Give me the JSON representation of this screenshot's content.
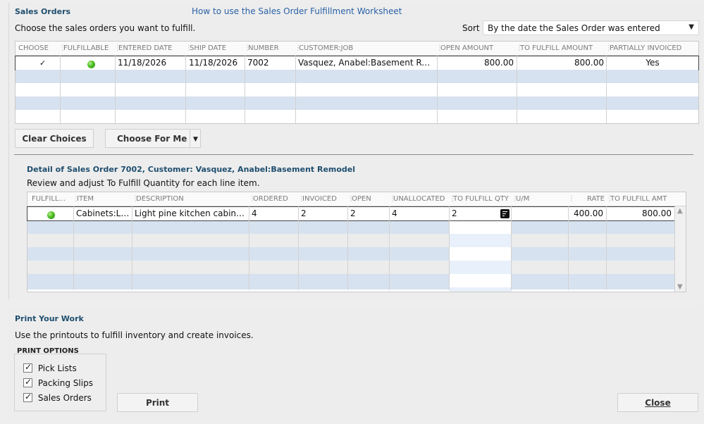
{
  "sales_orders": {
    "title": "Sales Orders",
    "help_link": "How to use the Sales Order Fulfillment Worksheet",
    "instruction": "Choose the sales orders you want to fulfill.",
    "sort_label": "Sort",
    "sort_value": "By the date the Sales Order was entered",
    "columns": [
      "CHOOSE",
      "FULFILLABLE",
      "ENTERED DATE",
      "SHIP DATE",
      "NUMBER",
      "CUSTOMER:JOB",
      "OPEN AMOUNT",
      "TO FULFILL AMOUNT",
      "PARTIALLY INVOICED"
    ],
    "rows": [
      {
        "entered_date": "11/18/2026",
        "ship_date": "11/18/2026",
        "number": "7002",
        "customer_job": "Vasquez, Anabel:Basement Remo...",
        "open_amount": "800.00",
        "to_fulfill_amount": "800.00",
        "partially_invoiced": "Yes",
        "chosen": true
      }
    ]
  },
  "buttons": {
    "clear_choices": "Clear Choices",
    "choose_for_me": "Choose For Me",
    "print": "Print",
    "close": "Close"
  },
  "detail": {
    "title": "Detail of Sales Order 7002, Customer: Vasquez, Anabel:Basement Remodel",
    "instruction": "Review and adjust To Fulfill Quantity for each line item.",
    "columns": [
      "FULFILL...",
      "ITEM",
      "DESCRIPTION",
      "ORDERED",
      "INVOICED",
      "OPEN",
      "UNALLOCATED",
      "TO FULFILL QTY",
      "U/M",
      "RATE",
      "TO FULFILL AMT"
    ],
    "rows": [
      {
        "item": "Cabinets:Lig...",
        "description": "Light pine kitchen cabinet w...",
        "ordered": "4",
        "invoiced": "2",
        "open": "2",
        "unallocated": "4",
        "to_fulfill_qty": "2",
        "um": "",
        "rate": "400.00",
        "to_fulfill_amt": "800.00"
      }
    ]
  },
  "print_work": {
    "title": "Print Your Work",
    "instruction": "Use the printouts to fulfill inventory and create invoices.",
    "options_title": "PRINT OPTIONS",
    "options": [
      {
        "label": "Pick Lists",
        "checked": true
      },
      {
        "label": "Packing Slips",
        "checked": true
      },
      {
        "label": "Sales Orders",
        "checked": true
      }
    ]
  },
  "icons": {
    "fulfillable": "green-dot-icon",
    "qty_lookup": "calculator-icon",
    "dropdown": "chevron-down-icon"
  },
  "colors": {
    "title": "#1f4e6e",
    "link": "#2a62a6",
    "alt_row": "#d7e2f0",
    "status_green": "#4cbd23"
  }
}
